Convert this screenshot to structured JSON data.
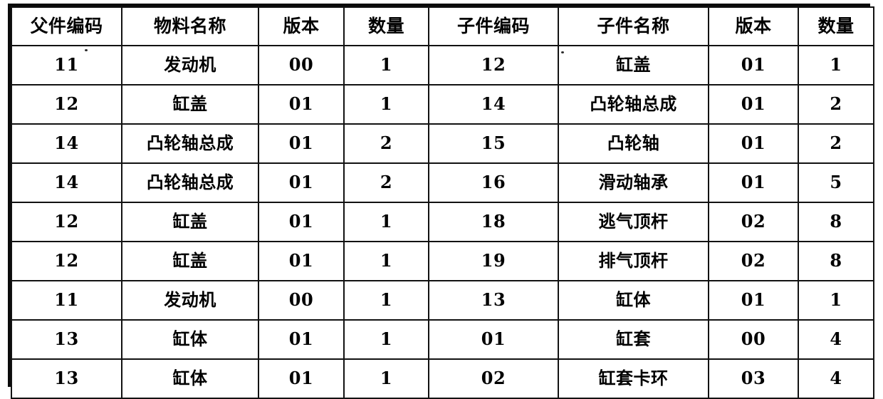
{
  "table": {
    "headers": [
      "父件编码",
      "物料名称",
      "版本",
      "数量",
      "子件编码",
      "子件名称",
      "版本",
      "数量"
    ],
    "rows": [
      {
        "parent_code": "11",
        "material_name": "发动机",
        "version_1": "00",
        "qty_1": "1",
        "child_code": "12",
        "child_name": "缸盖",
        "version_2": "01",
        "qty_2": "1"
      },
      {
        "parent_code": "12",
        "material_name": "缸盖",
        "version_1": "01",
        "qty_1": "1",
        "child_code": "14",
        "child_name": "凸轮轴总成",
        "version_2": "01",
        "qty_2": "2"
      },
      {
        "parent_code": "14",
        "material_name": "凸轮轴总成",
        "version_1": "01",
        "qty_1": "2",
        "child_code": "15",
        "child_name": "凸轮轴",
        "version_2": "01",
        "qty_2": "2"
      },
      {
        "parent_code": "14",
        "material_name": "凸轮轴总成",
        "version_1": "01",
        "qty_1": "2",
        "child_code": "16",
        "child_name": "滑动轴承",
        "version_2": "01",
        "qty_2": "5"
      },
      {
        "parent_code": "12",
        "material_name": "缸盖",
        "version_1": "01",
        "qty_1": "1",
        "child_code": "18",
        "child_name": "逃气顶杆",
        "version_2": "02",
        "qty_2": "8"
      },
      {
        "parent_code": "12",
        "material_name": "缸盖",
        "version_1": "01",
        "qty_1": "1",
        "child_code": "19",
        "child_name": "排气顶杆",
        "version_2": "02",
        "qty_2": "8"
      },
      {
        "parent_code": "11",
        "material_name": "发动机",
        "version_1": "00",
        "qty_1": "1",
        "child_code": "13",
        "child_name": "缸体",
        "version_2": "01",
        "qty_2": "1"
      },
      {
        "parent_code": "13",
        "material_name": "缸体",
        "version_1": "01",
        "qty_1": "1",
        "child_code": "01",
        "child_name": "缸套",
        "version_2": "00",
        "qty_2": "4"
      },
      {
        "parent_code": "13",
        "material_name": "缸体",
        "version_1": "01",
        "qty_1": "1",
        "child_code": "02",
        "child_name": "缸套卡环",
        "version_2": "03",
        "qty_2": "4"
      }
    ]
  },
  "colors": {
    "ink": "#000000",
    "border": "#121212",
    "page": "#ffffff"
  }
}
